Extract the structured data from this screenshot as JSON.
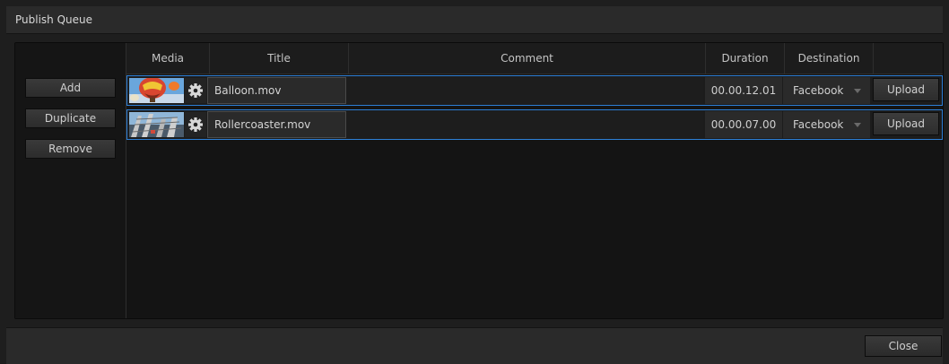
{
  "window": {
    "title": "Publish Queue"
  },
  "sidebar": {
    "add_label": "Add",
    "duplicate_label": "Duplicate",
    "remove_label": "Remove"
  },
  "table": {
    "columns": [
      "Media",
      "Title",
      "Comment",
      "Duration",
      "Destination"
    ],
    "rows": [
      {
        "thumbnail": "balloon-thumbnail",
        "title": "Balloon.mov",
        "comment": "",
        "duration": "00.00.12.01",
        "destination": "Facebook",
        "action_label": "Upload"
      },
      {
        "thumbnail": "rollercoaster-thumbnail",
        "title": "Rollercoaster.mov",
        "comment": "",
        "duration": "00.00.07.00",
        "destination": "Facebook",
        "action_label": "Upload"
      }
    ]
  },
  "footer": {
    "close_label": "Close"
  },
  "colors": {
    "selection_border": "#2d7fd6",
    "background": "#1e1e1e"
  },
  "icons": {
    "settings": "gear-icon",
    "dropdown": "chevron-down-icon"
  }
}
